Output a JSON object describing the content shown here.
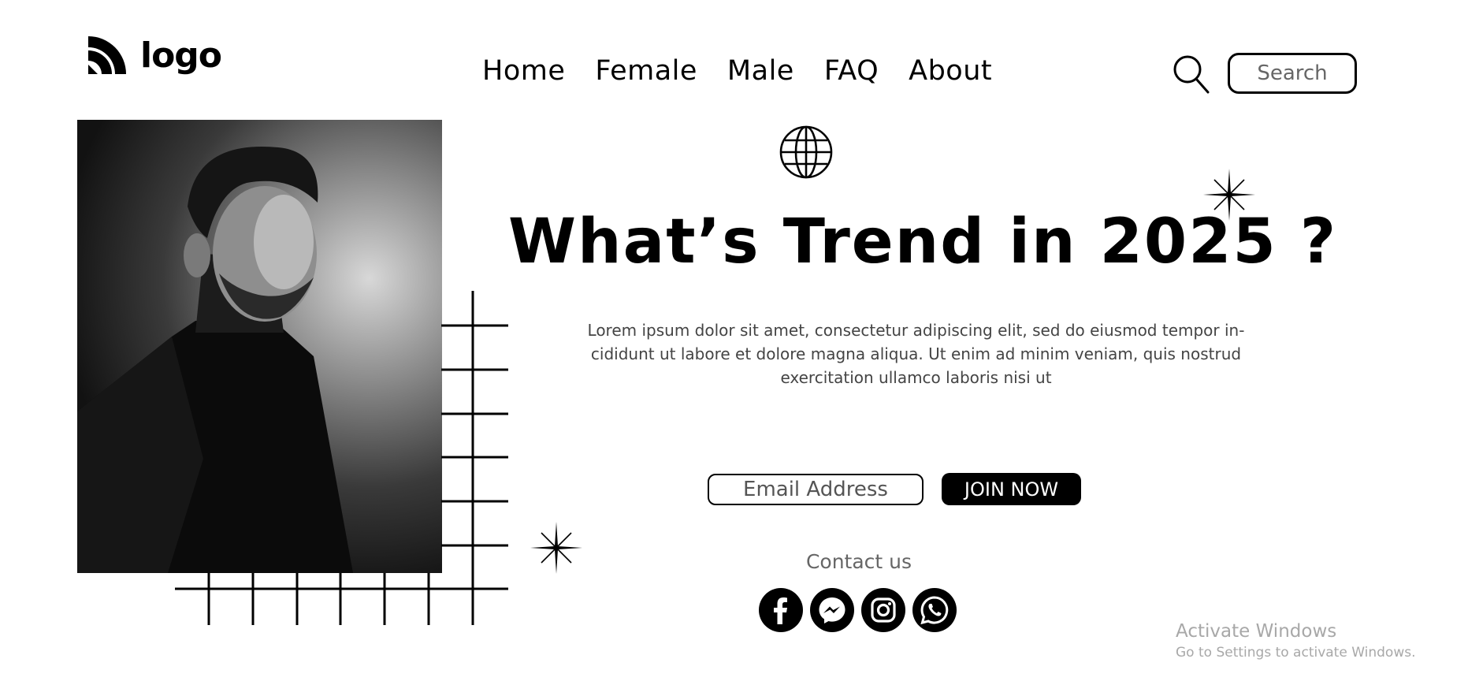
{
  "header": {
    "logo_text": "logo",
    "nav": [
      {
        "label": "Home"
      },
      {
        "label": "Female"
      },
      {
        "label": "Male"
      },
      {
        "label": "FAQ"
      },
      {
        "label": "About"
      }
    ],
    "search_placeholder": "Search"
  },
  "hero": {
    "title": "What’s Trend in 2025 ?",
    "description": "Lorem ipsum dolor sit amet, consectetur adipiscing elit, sed do eiusmod tempor in-cididunt ut labore et dolore magna aliqua. Ut enim ad minim veniam, quis nostrud exercitation ullamco laboris nisi ut",
    "email_placeholder": "Email Address",
    "join_label": "JOIN NOW"
  },
  "contact": {
    "label": "Contact us",
    "socials": [
      {
        "icon": "facebook-icon"
      },
      {
        "icon": "messenger-icon"
      },
      {
        "icon": "instagram-icon"
      },
      {
        "icon": "whatsapp-icon"
      }
    ]
  },
  "overlay": {
    "title": "Activate Windows",
    "subtitle": "Go to Settings to activate Windows."
  },
  "colors": {
    "primary": "#000000",
    "background": "#ffffff",
    "muted_text": "#666666",
    "watermark": "#a8a8a8"
  }
}
